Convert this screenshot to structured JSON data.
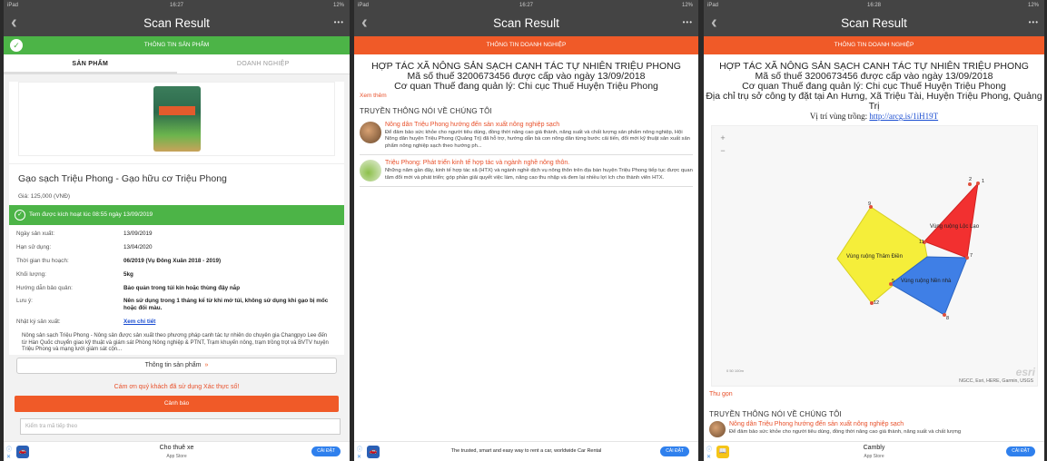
{
  "status": {
    "device": "iPad",
    "p1_time": "16:27",
    "p2_time": "16:27",
    "p3_time": "16:28",
    "battery": "12%"
  },
  "common": {
    "screen_title": "Scan Result",
    "more": "•••"
  },
  "panel1": {
    "section_title": "THÔNG TIN SẢN PHẨM",
    "tab_product": "SẢN PHẨM",
    "tab_business": "DOANH NGHIỆP",
    "product_name": "Gạo sạch Triệu Phong - Gạo hữu cơ Triệu Phong",
    "price": "Giá: 125,000 (VNĐ)",
    "activated": "Tem được kích hoạt lúc 08:55 ngày 13/09/2019",
    "rows": [
      {
        "k": "Ngày sản xuất:",
        "v": "13/09/2019"
      },
      {
        "k": "Hạn sử dụng:",
        "v": "13/04/2020"
      },
      {
        "k": "Thời gian thu hoạch:",
        "v": "06/2019 (Vụ Đông Xuân 2018 - 2019)"
      },
      {
        "k": "Khối lượng:",
        "v": "5kg"
      },
      {
        "k": "Hướng dẫn bảo quản:",
        "v": "Bảo quản trong túi kín hoặc thùng đậy nắp"
      },
      {
        "k": "Lưu ý:",
        "v": "Nên sử dụng trong 1 tháng kể từ khi mở túi, không sử dụng khi gạo bị mốc hoặc đổi màu."
      },
      {
        "k": "Nhật ký sản xuất:",
        "v": "Xem chi tiết"
      }
    ],
    "description": "Nông sản sạch Triệu Phong - Nông sản được sản xuất theo phương pháp canh tác tự nhiên do chuyên gia Changpyo Lee đến từ Hàn Quốc chuyển giao kỹ thuật và giám sát Phòng Nông nghiệp & PTNT, Trạm khuyến nông, trạm trồng trọt và BVTV huyện Triệu Phong và mạng lưới giám sát cộn...",
    "btn_product_info": "Thông tin sản phẩm",
    "btn_arrow": "»",
    "thanks": "Cám ơn quý khách đã sử dụng Xác thực số!",
    "btn_warning": "Cảnh báo",
    "search_placeholder": "Kiểm tra mã tiếp theo",
    "ad": {
      "title": "Cho thuê xe",
      "sub": "App Store",
      "btn": "CÀI ĐẶT"
    }
  },
  "panel2": {
    "section_title": "THÔNG TIN DOANH NGHIỆP",
    "company_name": "HỢP TÁC XÃ NÔNG SẢN SẠCH CANH TÁC TỰ NHIÊN TRIỆU PHONG",
    "tax": "Mã số thuế 3200673456 được cấp vào ngày 13/09/2018",
    "tax_office": "Cơ quan Thuế đang quản lý: Chi cục Thuế Huyện Triệu Phong",
    "more": "Xem thêm",
    "media_title": "TRUYỀN THÔNG NÓI VỀ CHÚNG TÔI",
    "news": [
      {
        "t": "Nông dân Triệu Phong hướng đến sản xuất nông nghiệp sạch",
        "d": "Để đảm bảo sức khỏe cho người tiêu dùng, đồng thời nâng cao giá thành, năng suất và chất lượng sản phẩm nông nghiệp, Hội Nông dân huyện Triệu Phong (Quảng Trị) đã hỗ trợ, hướng dẫn bà con nông dân từng bước cải tiến, đổi mới kỹ thuật sản xuất sản phẩm nông nghiệp sạch theo hướng ph..."
      },
      {
        "t": "Triệu Phong: Phát triển kinh tế hợp tác và ngành nghề nông thôn.",
        "d": "Những năm gần đây, kinh tế hợp tác xã (HTX) và ngành nghề dịch vụ nông thôn trên địa bàn huyện Triệu Phong tiếp tục được quan tâm đổi mới và phát triển; góp phần giải quyết việc làm, nâng cao thu nhập và đem lại nhiều lợi ích cho thành viên HTX."
      }
    ],
    "ad": {
      "title": "The trusted, smart and easy way to rent a car, worldwide Car Rental",
      "btn": "CÀI ĐẶT"
    }
  },
  "panel3": {
    "section_title": "THÔNG TIN DOANH NGHIỆP",
    "company_name": "HỢP TÁC XÃ NÔNG SẢN SẠCH CANH TÁC TỰ NHIÊN TRIỆU PHONG",
    "tax": "Mã số thuế 3200673456 được cấp vào ngày 13/09/2018",
    "tax_office": "Cơ quan Thuế đang quản lý: Chi cục Thuế Huyện Triệu Phong",
    "address": "Địa chỉ trụ sở công ty đặt tại An Hưng, Xã Triệu Tài, Huyện Triệu Phong, Quảng Trị",
    "location_label": "Vị trí vùng trồng:",
    "location_link": "http://arcg.is/1iH19T",
    "map_labels": {
      "a": "Vùng ruộng Lộc Lạo",
      "b": "Vùng ruộng Thâm Điền",
      "c": "Vùng ruộng Nền nhà"
    },
    "map_points": [
      "1",
      "2",
      "7",
      "8",
      "9",
      "11",
      "12",
      "5"
    ],
    "scale": "0  50  100m",
    "attribution": "NGCC, Esri, HERE, Garmin, USGS",
    "esri": "esri",
    "collapse": "Thu gọn",
    "media_title": "TRUYỀN THÔNG NÓI VỀ CHÚNG TÔI",
    "news1_t": "Nông dân Triệu Phong hướng đến sản xuất nông nghiệp sạch",
    "news1_d": "Để đảm bảo sức khỏe cho người tiêu dùng, đồng thời nâng cao giá thành, năng suất và chất lượng",
    "ad": {
      "title": "Cambly",
      "sub": "App Store",
      "btn": "CÀI ĐẶT"
    }
  }
}
